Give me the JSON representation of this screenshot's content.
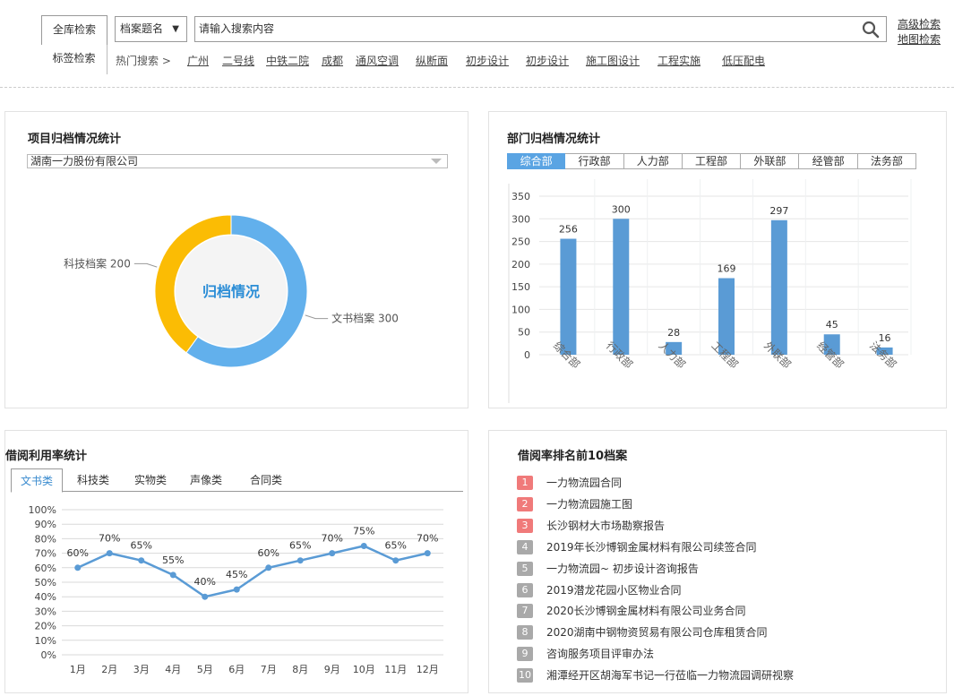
{
  "search": {
    "tab_all": "全库检索",
    "tab_tag": "标签检索",
    "field_select": "档案题名",
    "placeholder": "请输入搜索内容",
    "advanced": "高级检索",
    "map": "地图检索",
    "hot_label": "热门搜索 >",
    "hot_keywords": [
      "广州",
      "二号线",
      "中铁二院",
      "成都",
      "通风空调",
      "纵断面",
      "初步设计",
      "初步设计",
      "施工图设计",
      "工程实施",
      "低压配电"
    ]
  },
  "project": {
    "title": "项目归档情况统计",
    "company": "湖南一力股份有限公司",
    "center_label": "归档情况",
    "slices": [
      {
        "name": "科技档案",
        "value": 200,
        "color": "#fbbc04"
      },
      {
        "name": "文书档案",
        "value": 300,
        "color": "#62b0ec"
      }
    ]
  },
  "dept": {
    "title": "部门归档情况统计",
    "tabs": [
      "综合部",
      "行政部",
      "人力部",
      "工程部",
      "外联部",
      "经管部",
      "法务部"
    ],
    "active_tab": 0
  },
  "borrow": {
    "title": "借阅利用率统计",
    "tabs": [
      "文书类",
      "科技类",
      "实物类",
      "声像类",
      "合同类"
    ],
    "active_tab": 0
  },
  "ranking": {
    "title": "借阅率排名前10档案",
    "items": [
      {
        "rank": "1",
        "name": "一力物流园合同",
        "color": "#f07a7a"
      },
      {
        "rank": "2",
        "name": "一力物流园施工图",
        "color": "#f07a7a"
      },
      {
        "rank": "3",
        "name": "长沙钢材大市场勘察报告",
        "color": "#f07a7a"
      },
      {
        "rank": "4",
        "name": "2019年长沙博钢金属材料有限公司续签合同",
        "color": "#a9a9a9"
      },
      {
        "rank": "5",
        "name": "一力物流园~ 初步设计咨询报告",
        "color": "#a9a9a9"
      },
      {
        "rank": "6",
        "name": "2019潜龙花园小区物业合同",
        "color": "#a9a9a9"
      },
      {
        "rank": "7",
        "name": "2020长沙博钢金属材料有限公司业务合同",
        "color": "#a9a9a9"
      },
      {
        "rank": "8",
        "name": "2020湖南中钢物资贸易有限公司仓库租赁合同",
        "color": "#a9a9a9"
      },
      {
        "rank": "9",
        "name": "咨询服务项目评审办法",
        "color": "#a9a9a9"
      },
      {
        "rank": "10",
        "name": "湘潭经开区胡海军书记一行莅临一力物流园调研视察",
        "color": "#a9a9a9"
      }
    ]
  },
  "chart_data": [
    {
      "type": "pie",
      "title": "项目归档情况统计",
      "categories": [
        "科技档案",
        "文书档案"
      ],
      "values": [
        200,
        300
      ]
    },
    {
      "type": "bar",
      "title": "部门归档情况统计",
      "categories": [
        "综合部",
        "行政部",
        "人力部",
        "工程部",
        "外联部",
        "经管部",
        "法务部"
      ],
      "values": [
        256,
        300,
        28,
        169,
        297,
        45,
        16
      ],
      "yticks": [
        "0",
        "50",
        "100",
        "150",
        "200",
        "250",
        "300",
        "350"
      ],
      "ylim": [
        0,
        350
      ],
      "color": "#5a9bd5"
    },
    {
      "type": "line",
      "title": "借阅利用率统计",
      "categories": [
        "1月",
        "2月",
        "3月",
        "4月",
        "5月",
        "6月",
        "7月",
        "8月",
        "9月",
        "10月",
        "11月",
        "12月"
      ],
      "values": [
        60,
        70,
        65,
        55,
        40,
        45,
        60,
        65,
        70,
        75,
        65,
        70
      ],
      "yticks": [
        "0%",
        "10%",
        "20%",
        "30%",
        "40%",
        "50%",
        "60%",
        "70%",
        "80%",
        "90%",
        "100%"
      ],
      "ylim": [
        0,
        100
      ],
      "color": "#5a9bd5"
    }
  ]
}
